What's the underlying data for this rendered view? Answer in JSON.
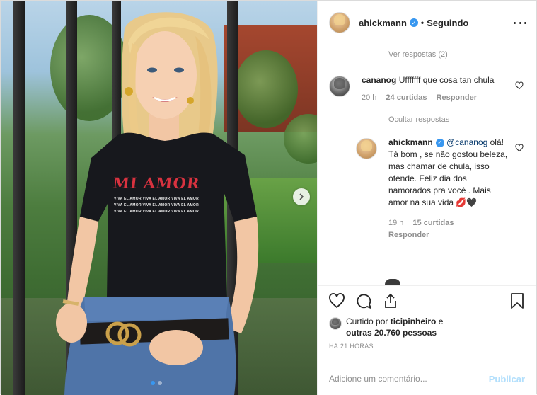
{
  "post": {
    "author": "ahickmann",
    "follow_status": "Seguindo",
    "shirt": {
      "title": "MI AMOR",
      "lines": [
        "VIVA EL AMOR  VIVA EL AMOR  VIVA EL AMOR",
        "VIVA EL AMOR  VIVA EL AMOR  VIVA EL AMOR",
        "VIVA EL AMOR  VIVA EL AMOR  VIVA EL AMOR"
      ]
    },
    "carousel": {
      "total": 2,
      "current": 1
    }
  },
  "comments": {
    "view_replies": "Ver respostas (2)",
    "items": [
      {
        "username": "cananog",
        "text": "Ufffffff que cosa tan chula",
        "time": "20 h",
        "likes": "24 curtidas",
        "reply": "Responder",
        "hide_replies": "Ocultar respostas"
      }
    ],
    "reply": {
      "username": "ahickmann",
      "mention": "@cananog",
      "text": "olá! Tá bom , se não gostou beleza, mas chamar de chula, isso ofende. Feliz dia dos namorados pra você . Mais amor na sua vida 💋🖤",
      "time": "19 h",
      "likes": "15 curtidas",
      "reply": "Responder"
    }
  },
  "likes": {
    "prefix": "Curtido por",
    "user": "ticipinheiro",
    "joiner": "e",
    "others": "outras 20.760 pessoas"
  },
  "timestamp": "HÁ 21 HORAS",
  "add_comment": {
    "placeholder": "Adicione um comentário...",
    "publish": "Publicar"
  },
  "colors": {
    "accent": "#3897f0",
    "publish_disabled": "#b2dffc",
    "muted": "#8e8e8e"
  }
}
